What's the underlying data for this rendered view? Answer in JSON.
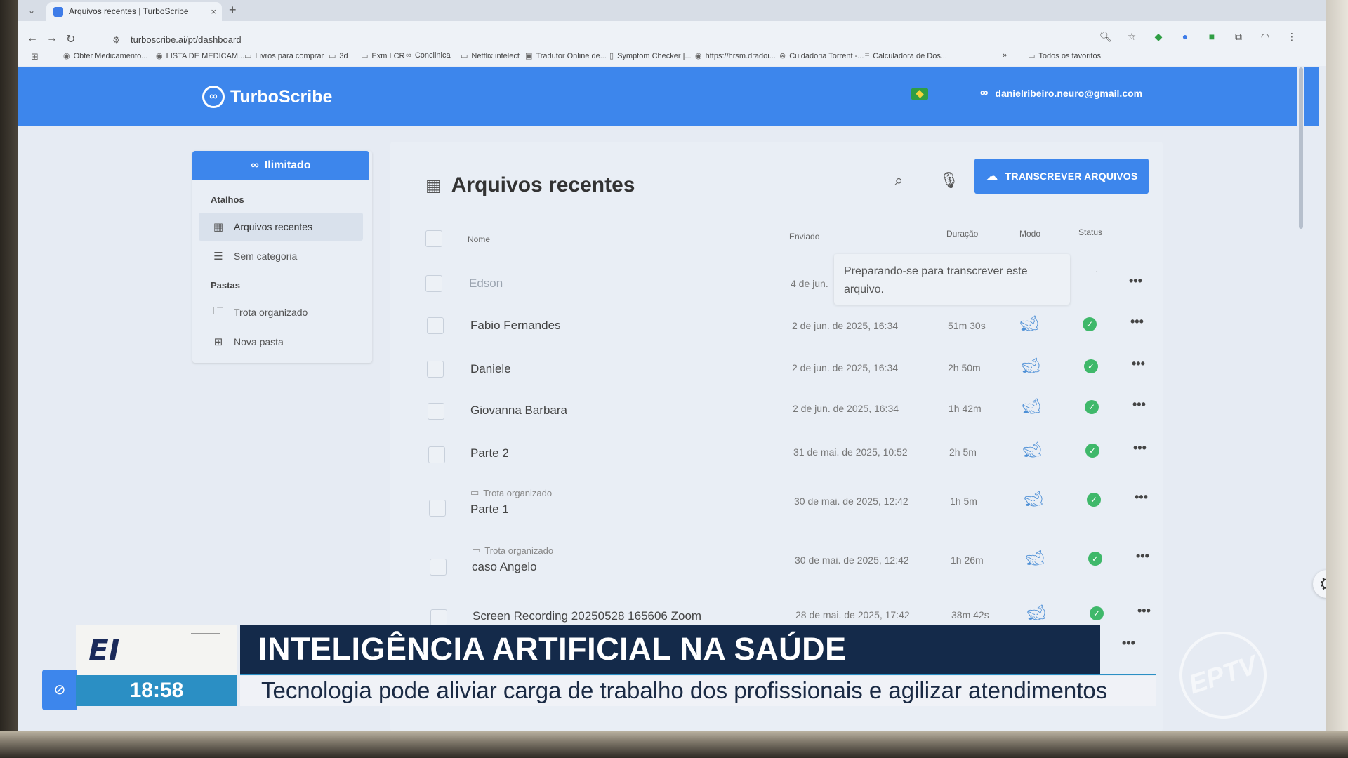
{
  "browser": {
    "tab_title": "Arquivos recentes | TurboScribe",
    "tab_close": "×",
    "new_tab": "+",
    "url": "turboscribe.ai/pt/dashboard",
    "bookmarks": [
      "Obter Medicamento...",
      "LISTA DE MEDICAM...",
      "Livros para comprar",
      "3d",
      "Exm LCR",
      "Conclinica",
      "Netflix intelect",
      "Tradutor Online de...",
      "Symptom Checker |...",
      "https://hrsm.dradoi...",
      "Cuidadoria Torrent -...",
      "Calculadora de Dos..."
    ],
    "bookmarks_more": "»",
    "all_bookmarks": "Todos os favoritos"
  },
  "header": {
    "brand": "TurboScribe",
    "user_email": "danielribeiro.neuro@gmail.com"
  },
  "sidebar": {
    "plan_label": "Ilimitado",
    "shortcuts_heading": "Atalhos",
    "recent_files": "Arquivos recentes",
    "uncategorized": "Sem categoria",
    "folders_heading": "Pastas",
    "folder_item": "Trota organizado",
    "new_folder": "Nova pasta"
  },
  "main": {
    "title": "Arquivos recentes",
    "transcribe_button": "TRANSCREVER ARQUIVOS",
    "columns": {
      "name": "Nome",
      "sent": "Enviado",
      "duration": "Duração",
      "mode": "Modo",
      "status": "Status"
    },
    "tooltip": "Preparando-se para transcrever este arquivo.",
    "rows": [
      {
        "name": "Edson",
        "folder": "",
        "date": "4 de jun.",
        "duration": "",
        "status": "pending"
      },
      {
        "name": "Fabio Fernandes",
        "folder": "",
        "date": "2 de jun. de 2025, 16:34",
        "duration": "51m 30s",
        "status": "done"
      },
      {
        "name": "Daniele",
        "folder": "",
        "date": "2 de jun. de 2025, 16:34",
        "duration": "2h 50m",
        "status": "done"
      },
      {
        "name": "Giovanna Barbara",
        "folder": "",
        "date": "2 de jun. de 2025, 16:34",
        "duration": "1h 42m",
        "status": "done"
      },
      {
        "name": "Parte 2",
        "folder": "",
        "date": "31 de mai. de 2025, 10:52",
        "duration": "2h 5m",
        "status": "done"
      },
      {
        "name": "Parte 1",
        "folder": "Trota organizado",
        "date": "30 de mai. de 2025, 12:42",
        "duration": "1h 5m",
        "status": "done"
      },
      {
        "name": "caso Angelo",
        "folder": "Trota organizado",
        "date": "30 de mai. de 2025, 12:42",
        "duration": "1h 26m",
        "status": "done"
      },
      {
        "name": "Screen Recording 20250528 165606 Zoom",
        "folder": "",
        "date": "28 de mai. de 2025, 17:42",
        "duration": "38m 42s",
        "status": "done"
      }
    ],
    "more_label": "•••",
    "status_done_mark": "✓"
  },
  "broadcast": {
    "logo_mark": "EI",
    "time": "18:58",
    "headline": "INTELIGÊNCIA ARTIFICIAL NA SAÚDE",
    "subheadline": "Tecnologia pode aliviar carga de trabalho dos profissionais e agilizar atendimentos",
    "watermark": "EPTV"
  },
  "colors": {
    "accent": "#3d86ec",
    "success": "#3fb86a",
    "broadcast_bar": "#142a4a",
    "broadcast_time": "#2b8fc4"
  },
  "icons": {
    "search": "search-icon",
    "microphone": "microphone-icon",
    "cloud_upload": "cloud-upload-icon",
    "grid": "grid-icon",
    "folder": "folder-icon",
    "mode": "whale-icon",
    "settings": "gear-icon"
  }
}
